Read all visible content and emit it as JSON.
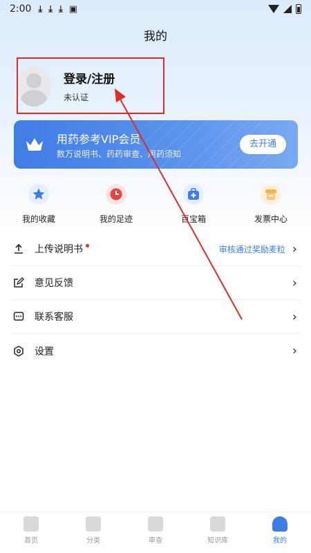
{
  "status_bar": {
    "time": "2:00"
  },
  "header": {
    "title": "我的"
  },
  "profile": {
    "login_label": "登录/注册",
    "auth_status": "未认证"
  },
  "vip": {
    "title": "用药参考VIP会员",
    "subtitle": "数万说明书、药药审查、用药须知",
    "button_label": "去开通"
  },
  "quick_actions": [
    {
      "label": "我的收藏",
      "icon": "star-icon",
      "color": "#3f7de3"
    },
    {
      "label": "我的足迹",
      "icon": "clock-icon",
      "color": "#e5453d"
    },
    {
      "label": "百宝箱",
      "icon": "toolbox-icon",
      "color": "#3f7de3"
    },
    {
      "label": "发票中心",
      "icon": "invoice-icon",
      "color": "#f1b24a"
    }
  ],
  "menu": [
    {
      "label": "上传说明书",
      "hint": "审核通过奖励麦粒",
      "icon": "upload-icon"
    },
    {
      "label": "意见反馈",
      "icon": "edit-icon"
    },
    {
      "label": "联系客服",
      "icon": "chat-icon"
    },
    {
      "label": "设置",
      "icon": "settings-icon"
    }
  ],
  "tabs": [
    {
      "label": "首页",
      "icon": "home-icon"
    },
    {
      "label": "分类",
      "icon": "grid-icon"
    },
    {
      "label": "审查",
      "icon": "check-icon"
    },
    {
      "label": "知识库",
      "icon": "book-icon"
    },
    {
      "label": "我的",
      "icon": "user-icon",
      "active": true
    }
  ],
  "colors": {
    "accent": "#3f7de3",
    "annotation": "#e02b2b"
  }
}
